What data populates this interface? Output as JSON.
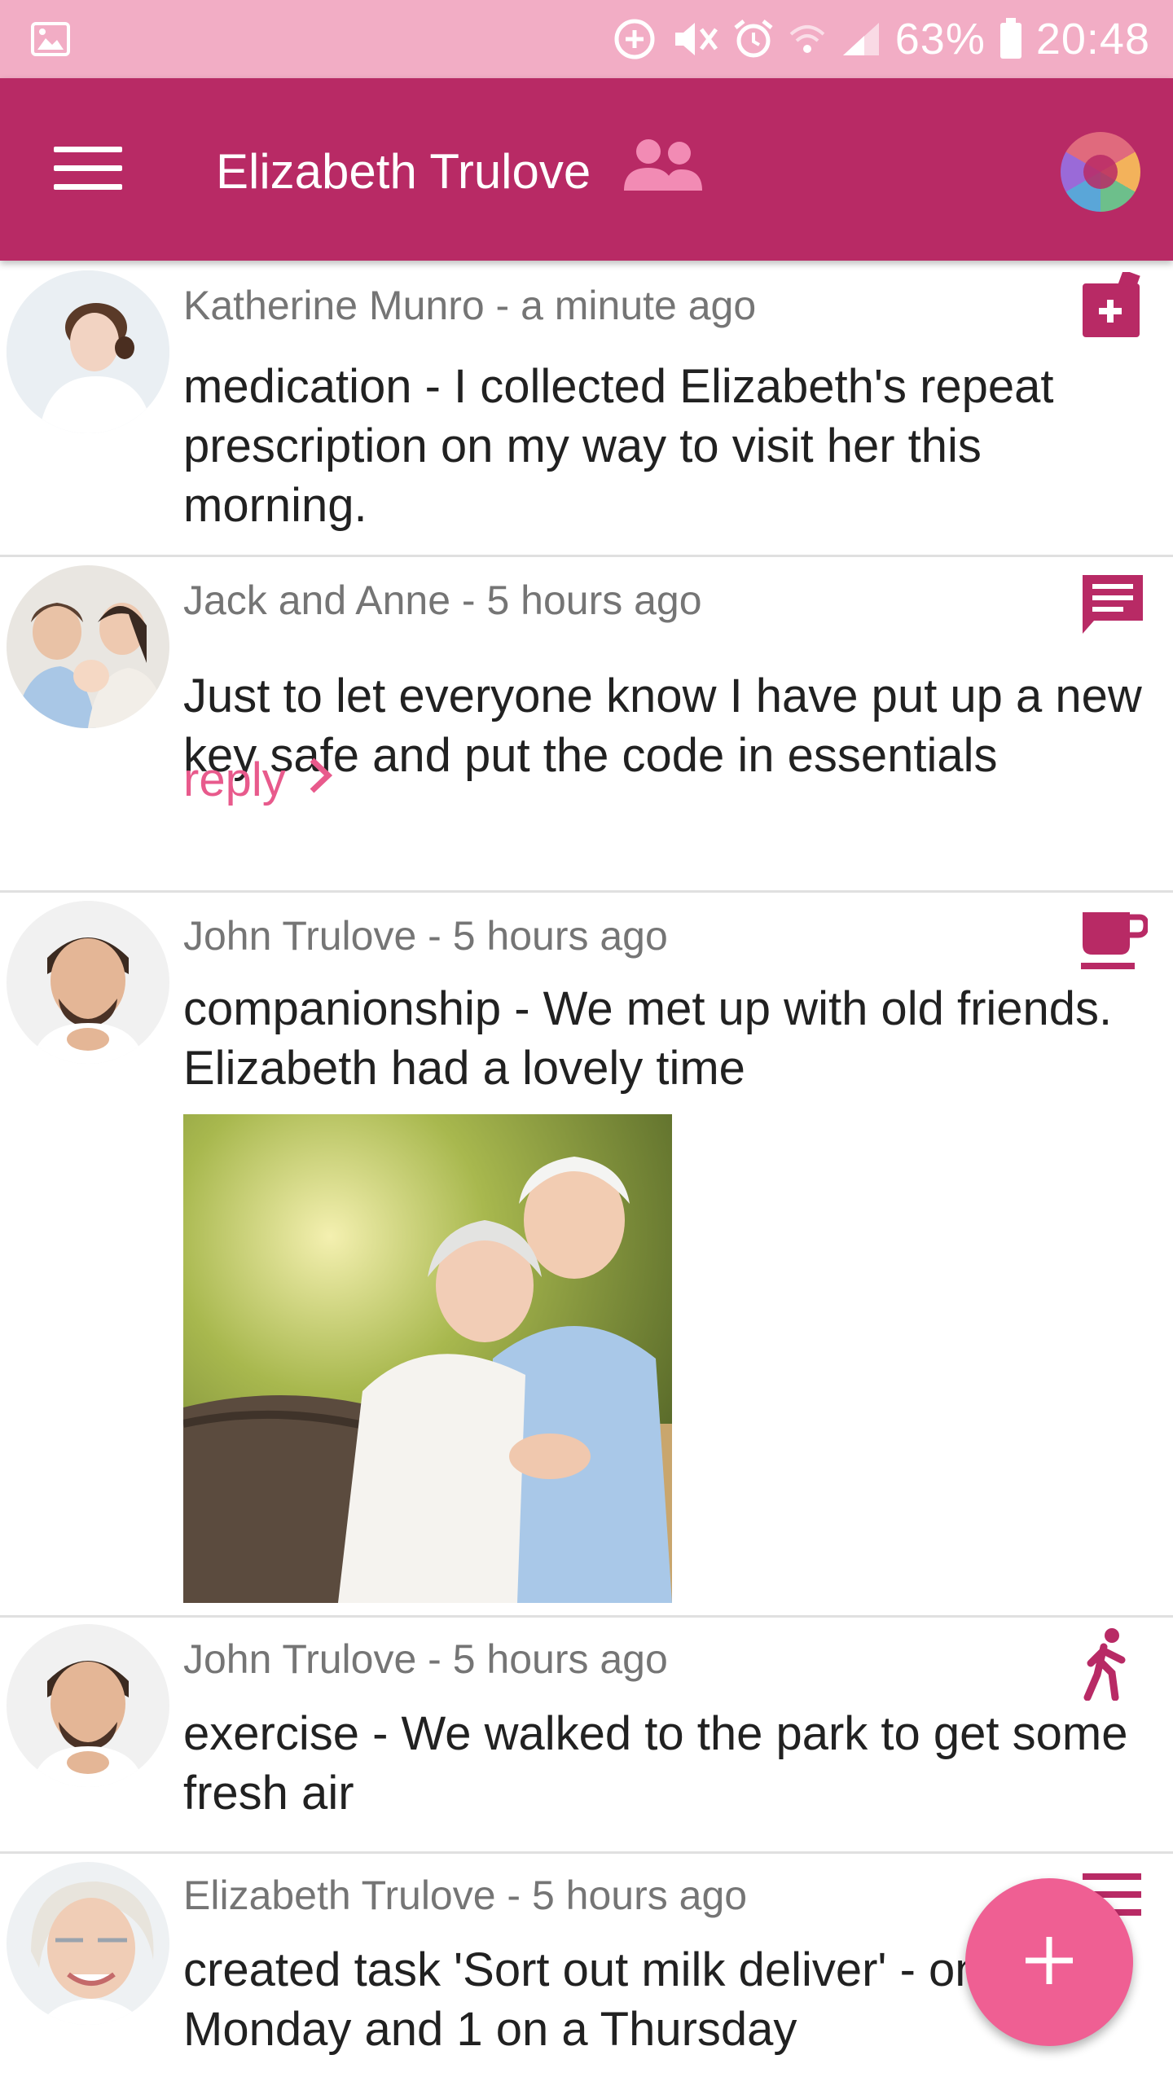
{
  "status_bar": {
    "battery": "63%",
    "time": "20:48",
    "icons": [
      "image-icon",
      "data-saver-icon",
      "mute-icon",
      "alarm-icon",
      "wifi-icon",
      "signal-icon",
      "battery-icon"
    ]
  },
  "app_bar": {
    "title": "Elizabeth Trulove",
    "menu_icon": "hamburger-menu-icon",
    "group_icon": "people-icon",
    "brand_icon": "app-logo-avatar"
  },
  "colors": {
    "status_bar": "#f2adc5",
    "app_bar": "#b82a65",
    "accent": "#e85a8c",
    "fab": "#ef5f93",
    "icon": "#b82a65"
  },
  "feed": [
    {
      "author": "Katherine Munro - a minute ago",
      "body": "medication - I collected Elizabeth's repeat prescription on my way to visit her this morning.",
      "icon": "medication-icon"
    },
    {
      "author": "Jack and Anne - 5 hours ago",
      "body": "Just to let everyone know I have put up a new key safe and put the code in essentials",
      "icon": "message-icon",
      "reply": "reply"
    },
    {
      "author": "John Trulove - 5 hours ago",
      "body": "companionship - We met up with old friends. Elizabeth had a lovely time",
      "icon": "coffee-cup-icon",
      "has_photo": true
    },
    {
      "author": "John Trulove - 5 hours ago",
      "body": "exercise - We walked to the park to get some fresh air",
      "icon": "walking-icon"
    },
    {
      "author": "Elizabeth Trulove - 5 hours ago",
      "body": "created task 'Sort out milk deliver' - on a Monday and 1 on a Thursday",
      "icon": "list-icon"
    }
  ],
  "fab": {
    "icon": "plus-icon"
  }
}
